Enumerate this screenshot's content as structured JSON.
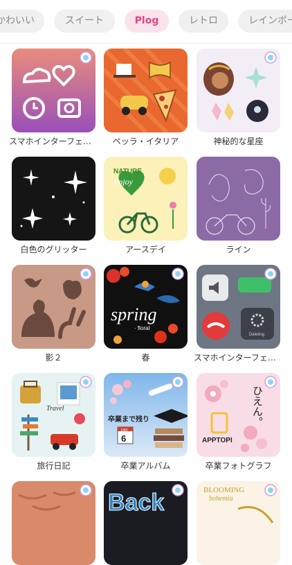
{
  "tabs": [
    {
      "label": "かわいい",
      "active": false
    },
    {
      "label": "スイート",
      "active": false
    },
    {
      "label": "Plog",
      "active": true
    },
    {
      "label": "レトロ",
      "active": false
    },
    {
      "label": "レインボー",
      "active": false
    }
  ],
  "cards": [
    {
      "caption": "スマホインターフェース"
    },
    {
      "caption": "ペッラ・イタリア"
    },
    {
      "caption": "神秘的な星座"
    },
    {
      "caption": "白色のグリッター"
    },
    {
      "caption": "アースデイ"
    },
    {
      "caption": "ライン"
    },
    {
      "caption": "影２"
    },
    {
      "caption": "春"
    },
    {
      "caption": "スマホインターフェース"
    },
    {
      "caption": "旅行日記"
    },
    {
      "caption": "卒業アルバム"
    },
    {
      "caption": "卒業フォトグラフ"
    },
    {
      "caption": ""
    },
    {
      "caption": ""
    },
    {
      "caption": ""
    }
  ],
  "thumb_text": {
    "nature": "NATURE",
    "enjoy": "Enjoy",
    "spring": "spring",
    "floral": "· floral",
    "travel": "Travel",
    "sotsugyo": "卒業まで残り",
    "day_label": "DAY",
    "day_num": "6",
    "hien": "ひえん。",
    "apptopi": "APPTOPI",
    "back": "Back",
    "blooming": "BLOOMING",
    "bohemia": "bohemia",
    "deleting": "Deleting"
  }
}
